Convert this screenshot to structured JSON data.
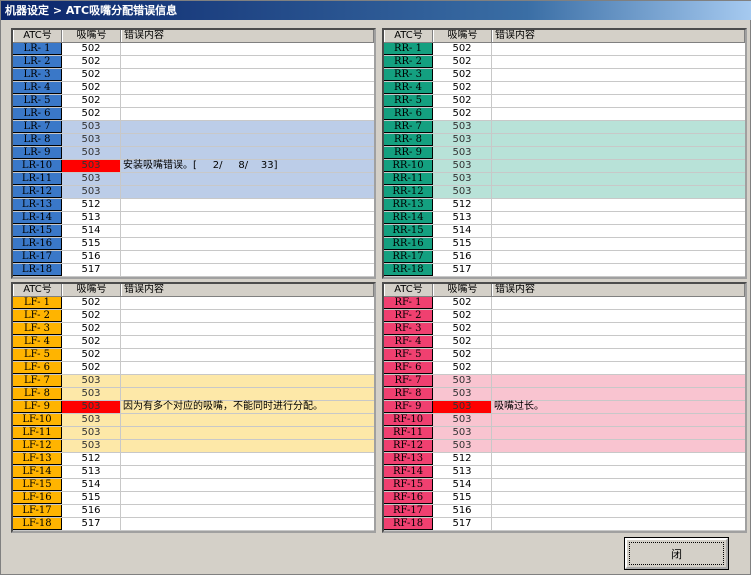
{
  "title": "机器设定 > ATC吸嘴分配错误信息",
  "headers": {
    "atc": "ATC号",
    "nozzle": "吸嘴号",
    "error": "错误内容"
  },
  "colors": {
    "error": "#ff0000"
  },
  "panels": [
    {
      "id": "LR",
      "atc_color": "#3a78c8",
      "highlight_color": "#bccde8",
      "highlight_rows": [
        7,
        8,
        9,
        10,
        11,
        12
      ],
      "error_row": 10,
      "rows": [
        [
          "LR- 1",
          "502",
          ""
        ],
        [
          "LR- 2",
          "502",
          ""
        ],
        [
          "LR- 3",
          "502",
          ""
        ],
        [
          "LR- 4",
          "502",
          ""
        ],
        [
          "LR- 5",
          "502",
          ""
        ],
        [
          "LR- 6",
          "502",
          ""
        ],
        [
          "LR- 7",
          "503",
          ""
        ],
        [
          "LR- 8",
          "503",
          ""
        ],
        [
          "LR- 9",
          "503",
          ""
        ],
        [
          "LR-10",
          "503",
          "安装吸嘴错误。[     2/     8/    33]"
        ],
        [
          "LR-11",
          "503",
          ""
        ],
        [
          "LR-12",
          "503",
          ""
        ],
        [
          "LR-13",
          "512",
          ""
        ],
        [
          "LR-14",
          "513",
          ""
        ],
        [
          "LR-15",
          "514",
          ""
        ],
        [
          "LR-16",
          "515",
          ""
        ],
        [
          "LR-17",
          "516",
          ""
        ],
        [
          "LR-18",
          "517",
          ""
        ]
      ]
    },
    {
      "id": "RR",
      "atc_color": "#14a080",
      "highlight_color": "#b8e2d8",
      "highlight_rows": [
        7,
        8,
        9,
        10,
        11,
        12
      ],
      "error_row": null,
      "rows": [
        [
          "RR- 1",
          "502",
          ""
        ],
        [
          "RR- 2",
          "502",
          ""
        ],
        [
          "RR- 3",
          "502",
          ""
        ],
        [
          "RR- 4",
          "502",
          ""
        ],
        [
          "RR- 5",
          "502",
          ""
        ],
        [
          "RR- 6",
          "502",
          ""
        ],
        [
          "RR- 7",
          "503",
          ""
        ],
        [
          "RR- 8",
          "503",
          ""
        ],
        [
          "RR- 9",
          "503",
          ""
        ],
        [
          "RR-10",
          "503",
          ""
        ],
        [
          "RR-11",
          "503",
          ""
        ],
        [
          "RR-12",
          "503",
          ""
        ],
        [
          "RR-13",
          "512",
          ""
        ],
        [
          "RR-14",
          "513",
          ""
        ],
        [
          "RR-15",
          "514",
          ""
        ],
        [
          "RR-16",
          "515",
          ""
        ],
        [
          "RR-17",
          "516",
          ""
        ],
        [
          "RR-18",
          "517",
          ""
        ]
      ]
    },
    {
      "id": "LF",
      "atc_color": "#ffb400",
      "highlight_color": "#fde8a8",
      "highlight_rows": [
        7,
        8,
        9,
        10,
        11,
        12
      ],
      "error_row": 9,
      "rows": [
        [
          "LF- 1",
          "502",
          ""
        ],
        [
          "LF- 2",
          "502",
          ""
        ],
        [
          "LF- 3",
          "502",
          ""
        ],
        [
          "LF- 4",
          "502",
          ""
        ],
        [
          "LF- 5",
          "502",
          ""
        ],
        [
          "LF- 6",
          "502",
          ""
        ],
        [
          "LF- 7",
          "503",
          ""
        ],
        [
          "LF- 8",
          "503",
          ""
        ],
        [
          "LF- 9",
          "503",
          "因为有多个对应的吸嘴，不能同时进行分配。"
        ],
        [
          "LF-10",
          "503",
          ""
        ],
        [
          "LF-11",
          "503",
          ""
        ],
        [
          "LF-12",
          "503",
          ""
        ],
        [
          "LF-13",
          "512",
          ""
        ],
        [
          "LF-14",
          "513",
          ""
        ],
        [
          "LF-15",
          "514",
          ""
        ],
        [
          "LF-16",
          "515",
          ""
        ],
        [
          "LF-17",
          "516",
          ""
        ],
        [
          "LF-18",
          "517",
          ""
        ]
      ]
    },
    {
      "id": "RF",
      "atc_color": "#f04070",
      "highlight_color": "#f9c4d0",
      "highlight_rows": [
        7,
        8,
        9,
        10,
        11,
        12
      ],
      "error_row": 9,
      "rows": [
        [
          "RF- 1",
          "502",
          ""
        ],
        [
          "RF- 2",
          "502",
          ""
        ],
        [
          "RF- 3",
          "502",
          ""
        ],
        [
          "RF- 4",
          "502",
          ""
        ],
        [
          "RF- 5",
          "502",
          ""
        ],
        [
          "RF- 6",
          "502",
          ""
        ],
        [
          "RF- 7",
          "503",
          ""
        ],
        [
          "RF- 8",
          "503",
          ""
        ],
        [
          "RF- 9",
          "503",
          "吸嘴过长。"
        ],
        [
          "RF-10",
          "503",
          ""
        ],
        [
          "RF-11",
          "503",
          ""
        ],
        [
          "RF-12",
          "503",
          ""
        ],
        [
          "RF-13",
          "512",
          ""
        ],
        [
          "RF-14",
          "513",
          ""
        ],
        [
          "RF-15",
          "514",
          ""
        ],
        [
          "RF-16",
          "515",
          ""
        ],
        [
          "RF-17",
          "516",
          ""
        ],
        [
          "RF-18",
          "517",
          ""
        ]
      ]
    }
  ],
  "close_label": "闭"
}
